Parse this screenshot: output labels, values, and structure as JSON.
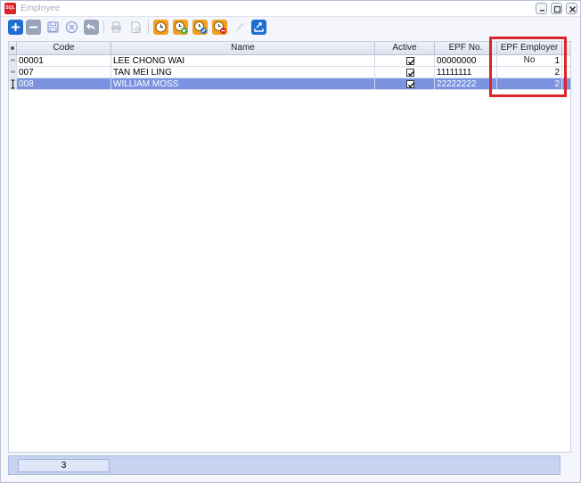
{
  "window": {
    "title": "Employee",
    "app_icon_text": "SQL"
  },
  "toolbar": {
    "buttons": [
      {
        "name": "add-icon",
        "enabled": true
      },
      {
        "name": "delete-icon",
        "enabled": true
      },
      {
        "name": "save-icon",
        "enabled": false
      },
      {
        "name": "cancel-icon",
        "enabled": false
      },
      {
        "name": "undo-icon",
        "enabled": true
      },
      {
        "name": "print-icon",
        "enabled": false
      },
      {
        "name": "preview-icon",
        "enabled": false
      },
      {
        "name": "clock-icon",
        "enabled": true
      },
      {
        "name": "clock-add-icon",
        "enabled": true
      },
      {
        "name": "clock-edit-icon",
        "enabled": true
      },
      {
        "name": "clock-remove-icon",
        "enabled": true
      },
      {
        "name": "pencil-icon",
        "enabled": false
      },
      {
        "name": "export-icon",
        "enabled": true
      }
    ]
  },
  "grid": {
    "columns": [
      "Code",
      "Name",
      "Active",
      "EPF No.",
      "EPF Employer No"
    ],
    "rows": [
      {
        "code": "00001",
        "name": "LEE CHONG WAI",
        "active": true,
        "epf_no": "00000000",
        "epf_employer_no": "1",
        "selected": false
      },
      {
        "code": "007",
        "name": "TAN MEI LING",
        "active": true,
        "epf_no": "11111111",
        "epf_employer_no": "2",
        "selected": false
      },
      {
        "code": "008",
        "name": "WILLIAM MOSS",
        "active": true,
        "epf_no": "22222222",
        "epf_employer_no": "2",
        "selected": true
      }
    ]
  },
  "status": {
    "record_count": "3"
  },
  "colors": {
    "selected_row": "#7b93e0",
    "highlight_box": "#d9262a",
    "accent_blue": "#1f6fd1",
    "accent_orange": "#f0a020"
  }
}
